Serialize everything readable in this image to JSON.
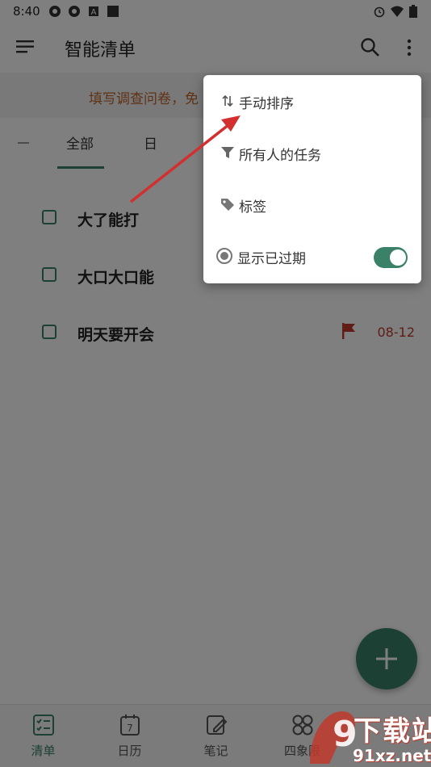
{
  "status_bar": {
    "time": "8:40",
    "icons": [
      "app-icon",
      "app-icon",
      "app-icon",
      "app-icon",
      "alarm-icon",
      "wifi-icon",
      "battery-icon"
    ]
  },
  "app_bar": {
    "title": "智能清单",
    "icons": [
      "menu-icon",
      "search-icon",
      "more-vert-icon"
    ]
  },
  "banner": {
    "text": "填写调查问卷，免"
  },
  "tabs": {
    "items": [
      "全部",
      "日"
    ],
    "accent_color": "#3b8168"
  },
  "tasks": [
    {
      "title": "大了能打",
      "date": ""
    },
    {
      "title": "大口大口能",
      "date": ""
    },
    {
      "title": "明天要开会",
      "date": "08-12",
      "flagged": true
    }
  ],
  "bottom_nav": {
    "items": [
      {
        "label": "清单",
        "icon": "checklist-icon",
        "active": true
      },
      {
        "label": "日历",
        "icon": "calendar-icon",
        "calendar_day": "7"
      },
      {
        "label": "笔记",
        "icon": "note-edit-icon"
      },
      {
        "label": "四象限",
        "icon": "quadrant-icon"
      }
    ]
  },
  "overflow_menu": {
    "items": [
      {
        "label": "手动排序",
        "icon": "sort-icon"
      },
      {
        "label": "所有人的任务",
        "icon": "filter-icon"
      },
      {
        "label": "标签",
        "icon": "tag-icon"
      },
      {
        "label": "显示已过期",
        "icon": "radio-icon",
        "toggle_on": true
      }
    ]
  },
  "watermark": {
    "line1": "下载站",
    "line2": "91xz.net"
  },
  "colors": {
    "accent": "#3b8168",
    "banner_text": "#c1642a",
    "due_date": "#c0392b",
    "annotation_arrow": "#d32f2f"
  }
}
